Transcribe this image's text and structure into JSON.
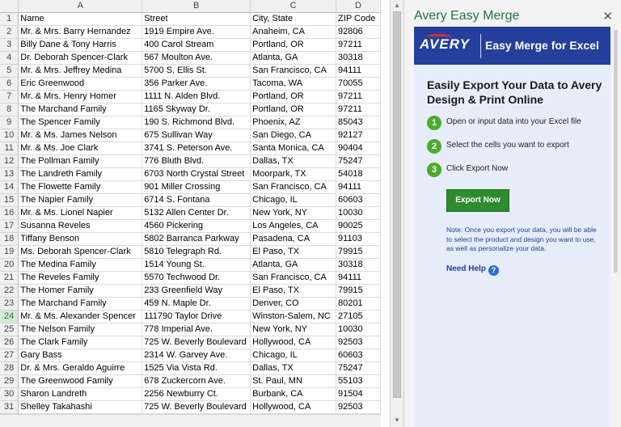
{
  "sheet": {
    "columns": [
      "A",
      "B",
      "C",
      "D"
    ],
    "selected_row": 24,
    "rows": [
      [
        "Name",
        "Street",
        "City, State",
        "ZIP Code"
      ],
      [
        "Mr. & Mrs. Barry Hernandez",
        "1919 Empire Ave.",
        "Anaheim, CA",
        "92806"
      ],
      [
        "Billy Dane & Tony Harris",
        "400 Carol Stream",
        "Portland, OR",
        "97211"
      ],
      [
        "Dr. Deborah Spencer-Clark",
        "567 Moulton Ave.",
        "Atlanta, GA",
        "30318"
      ],
      [
        "Mr. & Mrs. Jeffrey Medina",
        "5700 S. Ellis St.",
        "San Francisco, CA",
        "94111"
      ],
      [
        "Eric Greenwood",
        "356 Parker Ave.",
        "Tacoma, WA",
        "70055"
      ],
      [
        "Mr. & Mrs. Henry Homer",
        "1111 N. Alden Blvd.",
        "Portland, OR",
        "97211"
      ],
      [
        "The Marchand Family",
        "1165 Skyway Dr.",
        "Portland, OR",
        "97211"
      ],
      [
        "The Spencer Family",
        "190 S. Richmond Blvd.",
        "Phoenix, AZ",
        "85043"
      ],
      [
        "Mr. & Ms. James Nelson",
        "675 Sullivan Way",
        "San Diego, CA",
        "92127"
      ],
      [
        "Mr. & Ms. Joe Clark",
        "3741 S. Peterson Ave.",
        "Santa Monica, CA",
        "90404"
      ],
      [
        "The Pollman Family",
        "776 Bluth Blvd.",
        "Dallas, TX",
        "75247"
      ],
      [
        "The Landreth Family",
        "6703 North Crystal Street",
        "Moorpark, TX",
        "54018"
      ],
      [
        "The Flowette Family",
        "901 Miller Crossing",
        "San Francisco, CA",
        "94111"
      ],
      [
        "The Napier Family",
        "6714 S. Fontana",
        "Chicago, IL",
        "60603"
      ],
      [
        "Mr. & Ms. Lionel Napier",
        "5132 Allen Center Dr.",
        "New York, NY",
        "10030"
      ],
      [
        "Susanna Reveles",
        "4560 Pickering",
        "Los Angeles, CA",
        "90025"
      ],
      [
        "Tiffany Benson",
        "5802 Barranca Parkway",
        "Pasadena, CA",
        "91103"
      ],
      [
        "Ms. Deborah Spencer-Clark",
        "5810 Telegraph Rd.",
        "El Paso, TX",
        "79915"
      ],
      [
        "The Medina Family",
        "1514 Young St.",
        "Atlanta, GA",
        "30318"
      ],
      [
        "The Reveles Family",
        "5570 Techwood Dr.",
        "San Francisco, CA",
        "94111"
      ],
      [
        "The Homer Family",
        "233 Greenfield Way",
        "El Paso, TX",
        "79915"
      ],
      [
        "The Marchand Family",
        "459 N. Maple Dr.",
        "Denver, CO",
        "80201"
      ],
      [
        "Mr. & Ms. Alexander Spencer",
        "111790 Taylor Drive",
        "Winston-Salem, NC",
        "27105"
      ],
      [
        "The Nelson Family",
        "778 Imperial Ave.",
        "New York, NY",
        "10030"
      ],
      [
        "The Clark Family",
        "725 W. Beverly Boulevard",
        "Hollywood, CA",
        "92503"
      ],
      [
        "Gary Bass",
        "2314 W. Garvey Ave.",
        "Chicago, IL",
        "60603"
      ],
      [
        "Dr. & Mrs. Geraldo Aguirre",
        "1525 Via Vista Rd.",
        "Dallas, TX",
        "75247"
      ],
      [
        "The Greenwood Family",
        "678 Zuckercorn Ave.",
        "St. Paul, MN",
        "55103"
      ],
      [
        "Sharon Landreth",
        "2256 Newburry Ct.",
        "Burbank, CA",
        "91504"
      ],
      [
        "Shelley Takahashi",
        "725 W. Beverly Boulevard",
        "Hollywood, CA",
        "92503"
      ]
    ]
  },
  "pane": {
    "title": "Avery Easy Merge",
    "close_glyph": "✕",
    "logo_text": "AVERY",
    "banner_tag": "Easy Merge for Excel",
    "headline": "Easily Export Your Data to Avery Design & Print Online",
    "steps": [
      {
        "num": "1",
        "text": "Open or input data into your Excel file"
      },
      {
        "num": "2",
        "text": "Select the cells you want to export"
      },
      {
        "num": "3",
        "text": "Click Export Now"
      }
    ],
    "export_label": "Export Now",
    "note": "Note: Once you export your data, you will be able to select the product and design you want to use, as well as personalize your data.",
    "help_label": "Need Help",
    "help_glyph": "?"
  },
  "colors": {
    "excel_green": "#217346",
    "avery_blue": "#253f9c",
    "step_green": "#4bac2f",
    "button_green": "#2e8b2e",
    "avery_red": "#d92b2b"
  }
}
